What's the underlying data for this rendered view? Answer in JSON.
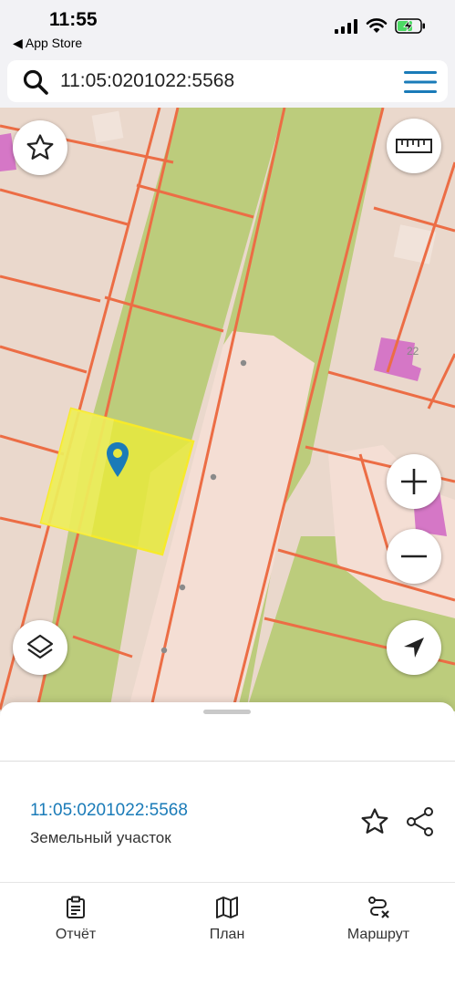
{
  "status_bar": {
    "time": "11:55",
    "back_app": "◀ App Store"
  },
  "search": {
    "value": "11:05:0201022:5568"
  },
  "map": {
    "house_number": "22"
  },
  "parcel": {
    "cadastral_number": "11:05:0201022:5568",
    "type": "Земельный участок"
  },
  "tabs": [
    {
      "label": "Отчёт",
      "icon": "report-icon"
    },
    {
      "label": "План",
      "icon": "map-plan-icon"
    },
    {
      "label": "Маршрут",
      "icon": "route-icon"
    }
  ],
  "colors": {
    "accent": "#1a7bb8",
    "parcel_highlight": "#e6e83f",
    "parcel_border": "#f6ea2a",
    "road": "#f4ded4",
    "green_zone": "#bccc7c",
    "boundary": "#ec6d45",
    "building": "#d577c6"
  }
}
